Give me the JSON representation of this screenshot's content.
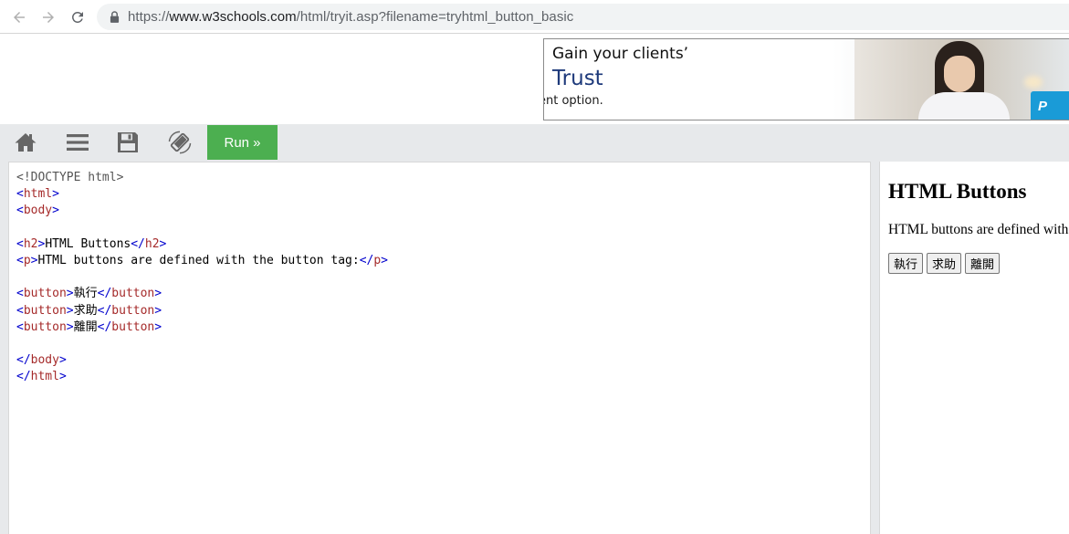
{
  "browser": {
    "url_prefix": "https://",
    "url_host": "www.w3schools.com",
    "url_path": "/html/tryit.asp?filename=tryhtml_button_basic"
  },
  "ad": {
    "headline": "Gain your clients’",
    "highlight": "Trust",
    "subtext": "ent option.",
    "badge": "P"
  },
  "toolbar": {
    "run_label": "Run »",
    "icons": [
      "home-icon",
      "menu-icon",
      "save-icon",
      "rotate-icon"
    ],
    "accent": "#4caf50"
  },
  "editor": {
    "lines": [
      {
        "doctype": "<!DOCTYPE html>"
      },
      {
        "tag": "html"
      },
      {
        "tag": "body"
      },
      {},
      {
        "tag": "h2",
        "text": "HTML Buttons",
        "close": "h2"
      },
      {
        "tag": "p",
        "text": "HTML buttons are defined with the button tag:",
        "close": "p"
      },
      {},
      {
        "tag": "button",
        "text": "執行",
        "close": "button"
      },
      {
        "tag": "button",
        "text": "求助",
        "close": "button"
      },
      {
        "tag": "button",
        "text": "離開",
        "close": "button"
      },
      {},
      {
        "close_only": "body"
      },
      {
        "close_only": "html"
      }
    ],
    "colors": {
      "tag": "#a52a2a",
      "bracket": "#0000cd"
    }
  },
  "result": {
    "heading": "HTML Buttons",
    "paragraph": "HTML buttons are defined with the button tag:",
    "buttons": [
      "執行",
      "求助",
      "離開"
    ]
  }
}
